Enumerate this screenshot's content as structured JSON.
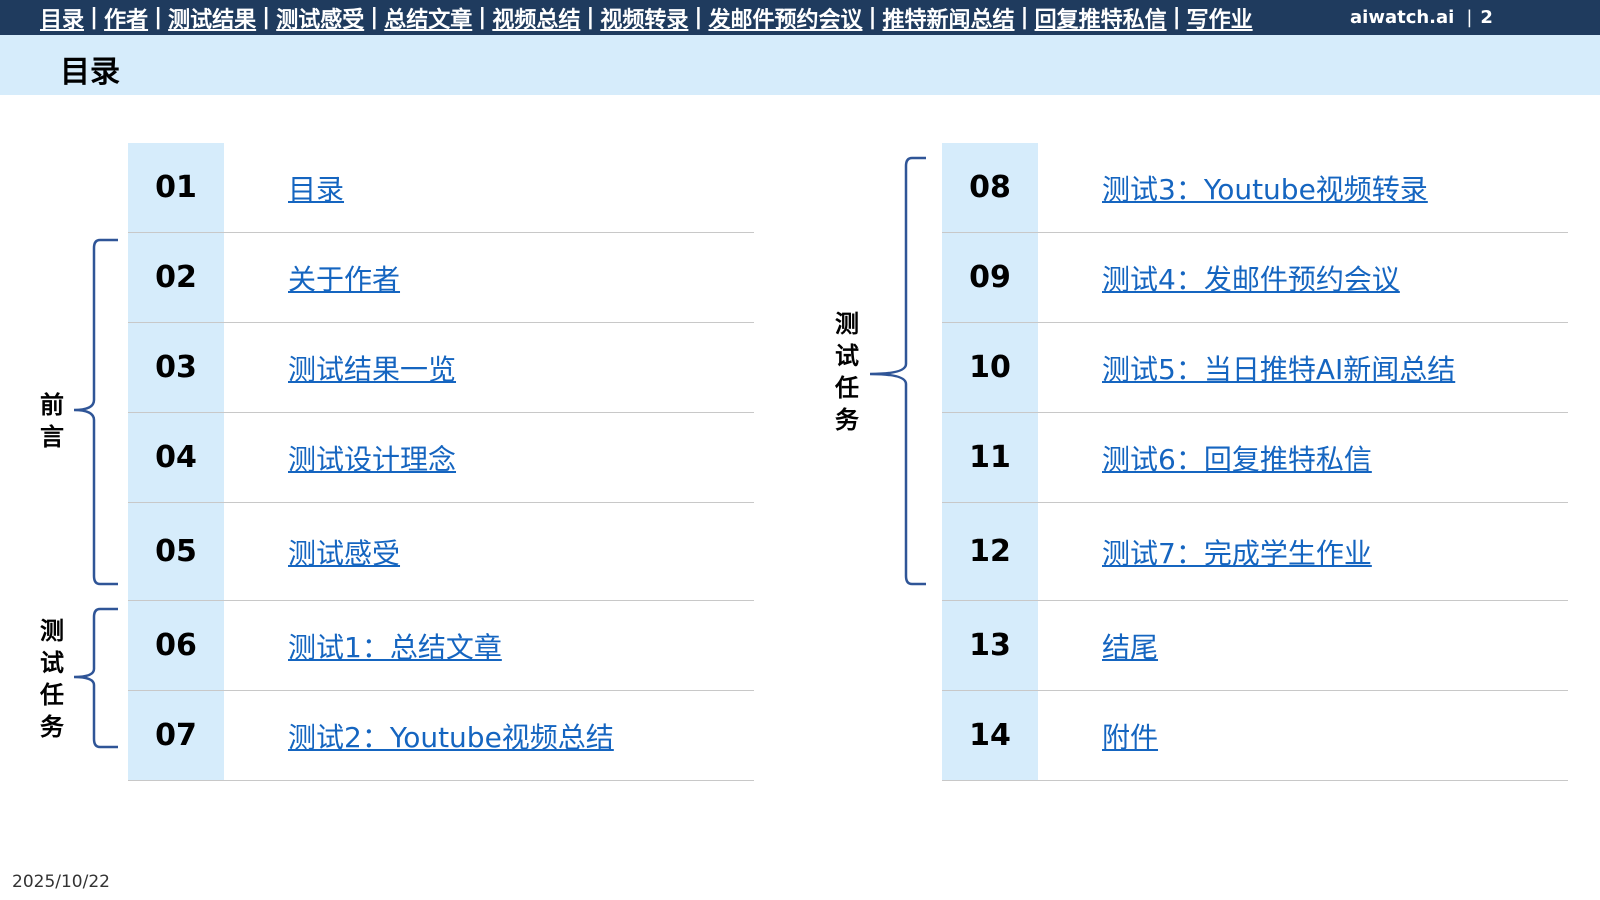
{
  "nav": {
    "items": [
      "目录",
      "作者",
      "测试结果",
      "测试感受",
      "总结文章",
      "视频总结",
      "视频转录",
      "发邮件预约会议",
      "推特新闻总结",
      "回复推特私信",
      "写作业"
    ],
    "separator": "|",
    "brand": "aiwatch.ai",
    "page_number": "2"
  },
  "page": {
    "title": "目录",
    "date": "2025/10/22"
  },
  "groups": {
    "preface": "前言",
    "tests_left": "测试任务",
    "tests_right": "测试任务"
  },
  "toc_left": [
    {
      "num": "01",
      "label": "目录"
    },
    {
      "num": "02",
      "label": "关于作者"
    },
    {
      "num": "03",
      "label": "测试结果一览"
    },
    {
      "num": "04",
      "label": "测试设计理念"
    },
    {
      "num": "05",
      "label": "测试感受"
    },
    {
      "num": "06",
      "label": "测试1：总结文章"
    },
    {
      "num": "07",
      "label": "测试2：Youtube视频总结"
    }
  ],
  "toc_right": [
    {
      "num": "08",
      "label": "测试3：Youtube视频转录"
    },
    {
      "num": "09",
      "label": "测试4：发邮件预约会议"
    },
    {
      "num": "10",
      "label": "测试5：当日推特AI新闻总结"
    },
    {
      "num": "11",
      "label": "测试6：回复推特私信"
    },
    {
      "num": "12",
      "label": "测试7：完成学生作业"
    },
    {
      "num": "13",
      "label": "结尾"
    },
    {
      "num": "14",
      "label": "附件"
    }
  ],
  "colors": {
    "nav_bg": "#1f3b5e",
    "title_band": "#d6ecfb",
    "link": "#1565c0",
    "brace": "#2f5597"
  }
}
